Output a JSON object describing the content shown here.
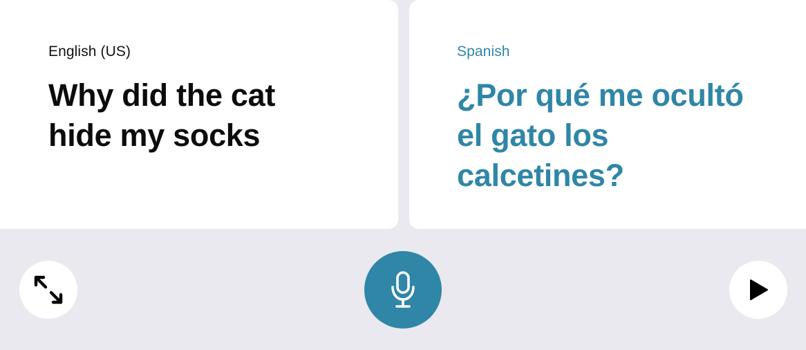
{
  "source_panel": {
    "language": "English (US)",
    "text": "Why did the cat hide my socks"
  },
  "target_panel": {
    "language": "Spanish",
    "text": "¿Por qué me ocultó el gato los calcetines?"
  },
  "controls": {
    "expand_icon": "expand-arrows-icon",
    "mic_icon": "microphone-icon",
    "play_icon": "play-icon"
  },
  "colors": {
    "accent": "#2f86a6",
    "background": "#e9e9ef",
    "card": "#ffffff",
    "source_text": "#0c0c0c"
  }
}
